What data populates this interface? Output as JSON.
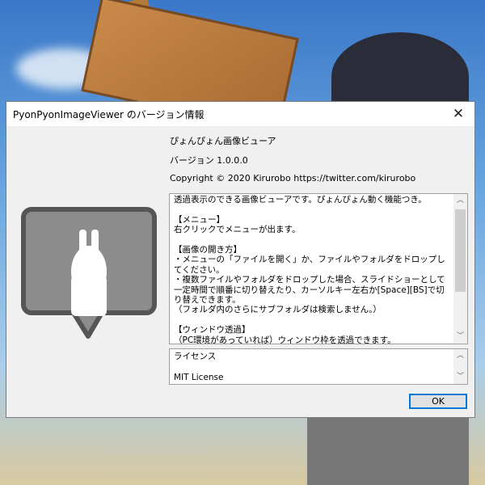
{
  "dialog": {
    "title": "PyonPyonImageViewer のバージョン情報",
    "product_name": "ぴょんぴょん画像ビューア",
    "version": "バージョン 1.0.0.0",
    "copyright": "Copyright ©  2020 Kirurobo  https://twitter.com/kirurobo",
    "description": "透過表示のできる画像ビューアです。ぴょんぴょん動く機能つき。\n\n【メニュー】\n右クリックでメニューが出ます。\n\n【画像の開き方】\n・メニューの「ファイルを開く」か、ファイルやフォルダをドロップしてください。\n・複数ファイルやフォルダをドロップした場合、スライドショーとして一定時間で順番に切り替えたり、カーソルキー左右か[Space][BS]で切り替えできます。\n（フォルダ内のさらにサブフォルダは検索しません。）\n\n【ウィンドウ透過】\n（PC環境があっていれば）ウィンドウ枠を透過できます。\n [Shift] キーを押している間は一時的に透過は無効となりサイズ調整など",
    "license": "ライセンス\n\nMIT License",
    "ok_label": "OK",
    "close_icon": "close-icon"
  }
}
